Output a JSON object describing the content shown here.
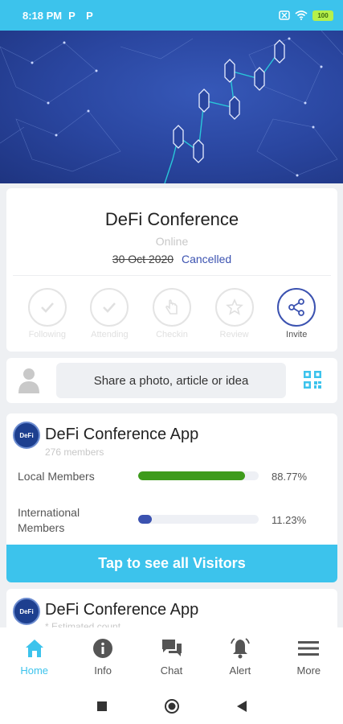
{
  "status_bar": {
    "time": "8:18 PM",
    "notif_icon_1": "P",
    "notif_icon_2": "P",
    "battery": "100"
  },
  "event": {
    "title": "DeFi Conference",
    "mode": "Online",
    "date": "30 Oct 2020",
    "status": "Cancelled",
    "actions": [
      {
        "label": "Following",
        "icon": "check-icon",
        "enabled": false
      },
      {
        "label": "Attending",
        "icon": "check-icon",
        "enabled": false
      },
      {
        "label": "Checkin",
        "icon": "hand-icon",
        "enabled": false
      },
      {
        "label": "Review",
        "icon": "star-icon",
        "enabled": false
      },
      {
        "label": "Invite",
        "icon": "share-icon",
        "enabled": true
      }
    ]
  },
  "share": {
    "placeholder": "Share a photo, article or idea"
  },
  "community": {
    "logo_text": "DeFi",
    "name": "DeFi Conference App",
    "members": "276 members",
    "stats": [
      {
        "label": "Local Members",
        "percent_text": "88.77%",
        "fraction": 0.8877,
        "color": "#3e9b1c"
      },
      {
        "label": "International Members",
        "percent_text": "11.23%",
        "fraction": 0.1123,
        "color": "#3b52b0"
      }
    ],
    "visitors_button": "Tap to see all Visitors"
  },
  "community2": {
    "logo_text": "DeFi",
    "name": "DeFi Conference App",
    "note": "* Estimated count"
  },
  "nav": [
    {
      "label": "Home",
      "icon": "home-icon",
      "active": true
    },
    {
      "label": "Info",
      "icon": "info-icon",
      "active": false
    },
    {
      "label": "Chat",
      "icon": "chat-icon",
      "active": false
    },
    {
      "label": "Alert",
      "icon": "bell-icon",
      "active": false
    },
    {
      "label": "More",
      "icon": "menu-icon",
      "active": false
    }
  ],
  "colors": {
    "accent": "#3cc3ec",
    "brand_blue": "#3b52b0",
    "banner": "#2a46a0"
  }
}
